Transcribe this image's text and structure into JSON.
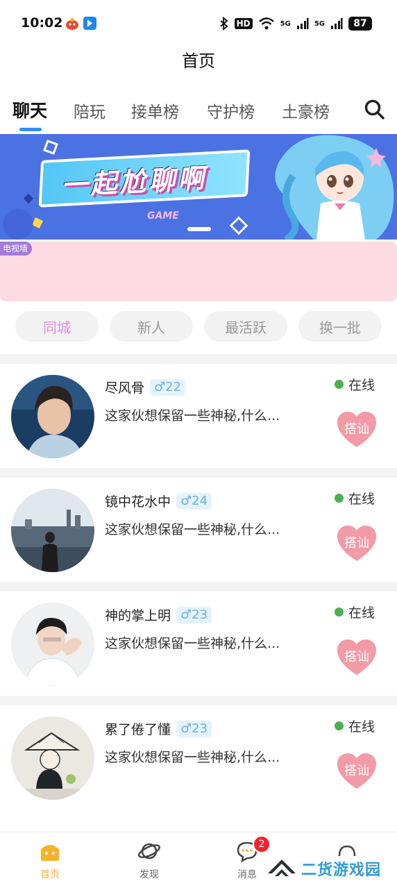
{
  "status_bar": {
    "time": "10:02",
    "hd": "HD",
    "network_1": "5G",
    "network_2": "5G",
    "battery": "87"
  },
  "header": {
    "title": "首页"
  },
  "tabs": [
    {
      "label": "聊天",
      "active": true
    },
    {
      "label": "陪玩"
    },
    {
      "label": "接单榜"
    },
    {
      "label": "守护榜"
    },
    {
      "label": "土豪榜"
    }
  ],
  "banner": {
    "headline": "一起尬聊啊",
    "subtitle": "GAME"
  },
  "tv_wall": {
    "label": "电视墙"
  },
  "filters": [
    {
      "label": "同城",
      "active": true
    },
    {
      "label": "新人"
    },
    {
      "label": "最活跃"
    },
    {
      "label": "换一批"
    }
  ],
  "users": [
    {
      "name": "尽风骨",
      "gender_age": "♂22",
      "bio": "这家伙想保留一些神秘,什么...",
      "status": "在线",
      "action": "搭讪"
    },
    {
      "name": "镜中花水中",
      "gender_age": "♂24",
      "bio": "这家伙想保留一些神秘,什么...",
      "status": "在线",
      "action": "搭讪"
    },
    {
      "name": "神的掌上明",
      "gender_age": "♂23",
      "bio": "这家伙想保留一些神秘,什么...",
      "status": "在线",
      "action": "搭讪"
    },
    {
      "name": "累了倦了懂",
      "gender_age": "♂23",
      "bio": "这家伙想保留一些神秘,什么...",
      "status": "在线",
      "action": "搭讪"
    }
  ],
  "bottom_nav": {
    "home": "首页",
    "discover": "发现",
    "messages": "消息",
    "messages_badge": "2"
  },
  "watermark": {
    "text": "二货游戏园"
  },
  "colors": {
    "accent_blue": "#2f8ef5",
    "active_chip": "#e28ae8",
    "online": "#4caf50",
    "chat_heart": "#f29aa6",
    "nav_active": "#f5b32b",
    "badge": "#f0232c"
  }
}
